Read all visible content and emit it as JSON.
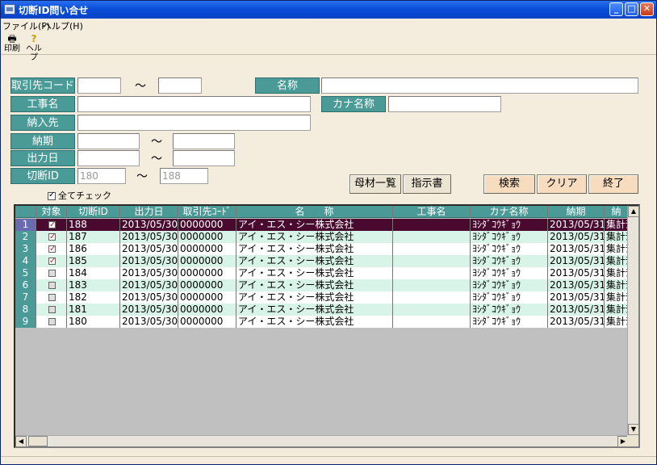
{
  "window": {
    "title": "切断ID問い合せ"
  },
  "menu": {
    "file": "ファイル(F)",
    "help": "ヘルプ(H)"
  },
  "toolbar": {
    "print": "印刷",
    "help": "ヘルプ"
  },
  "form": {
    "torihikisaki_label": "取引先コード",
    "meisho_label": "名称",
    "kouji_label": "工事名",
    "kana_label": "カナ名称",
    "nounyu_label": "納入先",
    "nouki_label": "納期",
    "shukka_label": "出力日",
    "setsudan_label": "切断ID",
    "setsudan_from": "180",
    "setsudan_to": "188",
    "tilde": "～"
  },
  "buttons": {
    "bozai": "母材一覧",
    "shiji": "指示書",
    "search": "検索",
    "clear": "クリア",
    "exit": "終了"
  },
  "check_all": {
    "label": "全てチェック",
    "checked": true
  },
  "grid": {
    "headers": [
      "対象",
      "切断ID",
      "出力日",
      "取引先ｺｰﾄﾞ",
      "名　　称",
      "工事名",
      "カナ名称",
      "納期",
      "納"
    ],
    "rows": [
      {
        "no": "1",
        "checked": true,
        "id": "188",
        "date": "2013/05/30",
        "code": "0000000",
        "name": "アイ・エス・シー株式会社",
        "kouji": "",
        "kana": "ﾖｼﾀﾞｺｳｷﾞｮｳ",
        "nouki": "2013/05/31",
        "nounyu": "集計ﾃ"
      },
      {
        "no": "2",
        "checked": true,
        "id": "187",
        "date": "2013/05/30",
        "code": "0000000",
        "name": "アイ・エス・シー株式会社",
        "kouji": "",
        "kana": "ﾖｼﾀﾞｺｳｷﾞｮｳ",
        "nouki": "2013/05/31",
        "nounyu": "集計ﾃ"
      },
      {
        "no": "3",
        "checked": true,
        "id": "186",
        "date": "2013/05/30",
        "code": "0000000",
        "name": "アイ・エス・シー株式会社",
        "kouji": "",
        "kana": "ﾖｼﾀﾞｺｳｷﾞｮｳ",
        "nouki": "2013/05/31",
        "nounyu": "集計ﾃ"
      },
      {
        "no": "4",
        "checked": true,
        "id": "185",
        "date": "2013/05/30",
        "code": "0000000",
        "name": "アイ・エス・シー株式会社",
        "kouji": "",
        "kana": "ﾖｼﾀﾞｺｳｷﾞｮｳ",
        "nouki": "2013/05/31",
        "nounyu": "集計ﾃ"
      },
      {
        "no": "5",
        "checked": false,
        "id": "184",
        "date": "2013/05/30",
        "code": "0000000",
        "name": "アイ・エス・シー株式会社",
        "kouji": "",
        "kana": "ﾖｼﾀﾞｺｳｷﾞｮｳ",
        "nouki": "2013/05/31",
        "nounyu": "集計ﾃ"
      },
      {
        "no": "6",
        "checked": false,
        "id": "183",
        "date": "2013/05/30",
        "code": "0000000",
        "name": "アイ・エス・シー株式会社",
        "kouji": "",
        "kana": "ﾖｼﾀﾞｺｳｷﾞｮｳ",
        "nouki": "2013/05/31",
        "nounyu": "集計ﾃ"
      },
      {
        "no": "7",
        "checked": false,
        "id": "182",
        "date": "2013/05/30",
        "code": "0000000",
        "name": "アイ・エス・シー株式会社",
        "kouji": "",
        "kana": "ﾖｼﾀﾞｺｳｷﾞｮｳ",
        "nouki": "2013/05/31",
        "nounyu": "集計ﾃ"
      },
      {
        "no": "8",
        "checked": false,
        "id": "181",
        "date": "2013/05/30",
        "code": "0000000",
        "name": "アイ・エス・シー株式会社",
        "kouji": "",
        "kana": "ﾖｼﾀﾞｺｳｷﾞｮｳ",
        "nouki": "2013/05/31",
        "nounyu": "集計ﾃ"
      },
      {
        "no": "9",
        "checked": false,
        "id": "180",
        "date": "2013/05/30",
        "code": "0000000",
        "name": "アイ・エス・シー株式会社",
        "kouji": "",
        "kana": "ﾖｼﾀﾞｺｳｷﾞｮｳ",
        "nouki": "2013/05/31",
        "nounyu": "集計ﾃ"
      }
    ]
  },
  "colors": {
    "label_teal": "#4a9a98",
    "selected_row": "#4a0a30",
    "alt_row": "#d8f4e8",
    "background": "#f4ecdc"
  }
}
